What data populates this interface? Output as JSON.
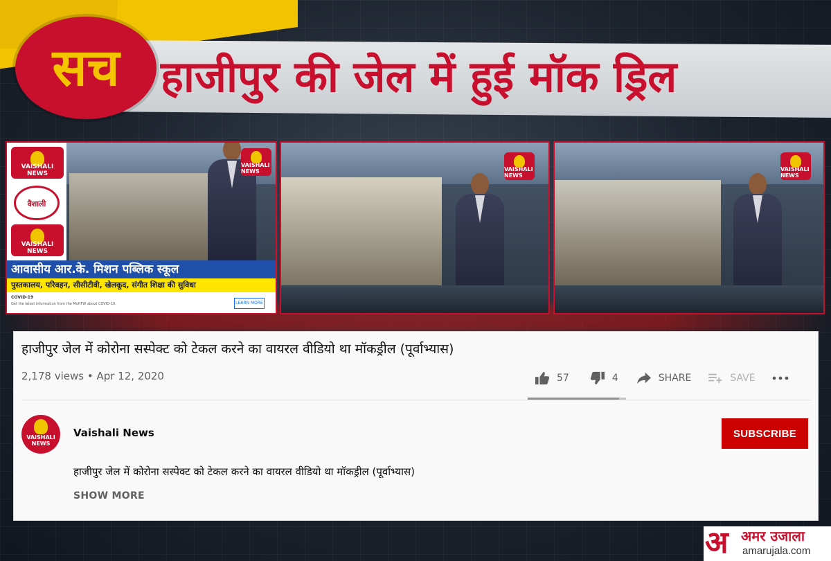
{
  "headline": {
    "badge": "सच",
    "text": "हाजीपुर की जेल में हुई मॉक ड्रिल"
  },
  "thumbnails": {
    "channel_badge": "VAISHALI NEWS",
    "school_line": "आवासीय आर.के. मिशन पब्लिक स्कूल",
    "school_sub": "पुस्तकालय, परिवहन, सीसीटीवी, खेलकूद, संगीत शिक्षा की सुविधा",
    "covid_title": "COVID-19",
    "covid_desc": "Get the latest information from the MoHFW about COVID-19.",
    "learn_more": "LEARN MORE"
  },
  "video": {
    "title": "हाजीपुर जेल में कोरोना सस्पेक्ट को टेकल करने का वायरल वीडियो था मॉकड्रील (पूर्वाभ्यास)",
    "meta": "2,178 views • Apr 12, 2020",
    "likes": "57",
    "dislikes": "4",
    "share_label": "SHARE",
    "save_label": "SAVE",
    "sentiment_ratio": 0.93
  },
  "channel": {
    "name": "Vaishali News",
    "subscribe_label": "SUBSCRIBE",
    "description": "हाजीपुर जेल में कोरोना सस्पेक्ट को टेकल करने का वायरल वीडियो था मॉकड्रील (पूर्वाभ्यास)",
    "show_more_label": "SHOW MORE"
  },
  "brand": {
    "mark": "अ",
    "hindi_name": "अमर उजाला",
    "domain": "amarujala.com"
  },
  "colors": {
    "accent_red": "#c8102e",
    "accent_yellow": "#f2c300",
    "subscribe_red": "#cc0000"
  }
}
